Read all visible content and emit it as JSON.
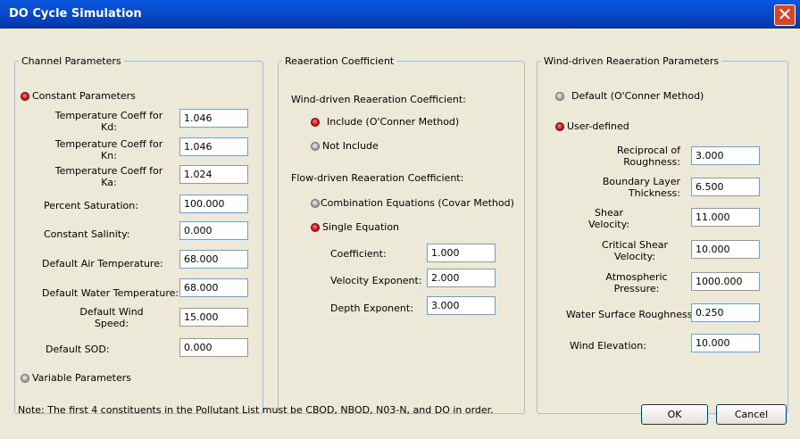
{
  "window": {
    "title": "DO Cycle Simulation",
    "close_symbol": "✕"
  },
  "channel": {
    "legend": "Channel Parameters",
    "constant_label": "Constant Parameters",
    "coeff_kd_label": "Temperature Coeff for Kd:",
    "coeff_kd_value": "1.046",
    "coeff_kn_label": "Temperature Coeff for Kn:",
    "coeff_kn_value": "1.046",
    "coeff_ka_label": "Temperature Coeff for Ka:",
    "coeff_ka_value": "1.024",
    "saturation_label": "Percent Saturation:",
    "saturation_value": "100.000",
    "salinity_label": "Constant Salinity:",
    "salinity_value": "0.000",
    "air_temp_label": "Default Air Temperature:",
    "air_temp_value": "68.000",
    "water_temp_label": "Default Water Temperature:",
    "water_temp_value": "68.000",
    "wind_speed_label": "Default Wind Speed:",
    "wind_speed_value": "15.000",
    "sod_label": "Default SOD:",
    "sod_value": "0.000",
    "variable_label": "Variable Parameters"
  },
  "reaeration": {
    "legend": "Reaeration Coefficient",
    "wind_heading": "Wind-driven Reaeration Coefficient:",
    "include_label": "Include (O'Conner Method)",
    "not_include_label": "Not Include",
    "flow_heading": "Flow-driven Reaeration Coefficient:",
    "combination_label": "Combination Equations (Covar Method)",
    "single_label": "Single Equation",
    "coefficient_label": "Coefficient:",
    "coefficient_value": "1.000",
    "velocity_exp_label": "Velocity Exponent:",
    "velocity_exp_value": "2.000",
    "depth_exp_label": "Depth Exponent:",
    "depth_exp_value": "3.000"
  },
  "wind": {
    "legend": "Wind-driven Reaeration Parameters",
    "default_label": "Default (O'Conner Method)",
    "user_label": "User-defined",
    "roughness_label": "Reciprocal of Roughness:",
    "roughness_value": "3.000",
    "boundary_label": "Boundary Layer Thickness:",
    "boundary_value": "6.500",
    "shear_label": "Shear Velocity:",
    "shear_value": "11.000",
    "critical_label": "Critical Shear Velocity:",
    "critical_value": "10.000",
    "pressure_label": "Atmospheric Pressure:",
    "pressure_value": "1000.000",
    "surface_label": "Water Surface Roughness:",
    "surface_value": "0.250",
    "elevation_label": "Wind Elevation:",
    "elevation_value": "10.000"
  },
  "note": "Note: The first 4 constituents in the Pollutant List must be CBOD, NBOD, N03-N, and DO in order.",
  "buttons": {
    "ok": "OK",
    "cancel": "Cancel"
  }
}
